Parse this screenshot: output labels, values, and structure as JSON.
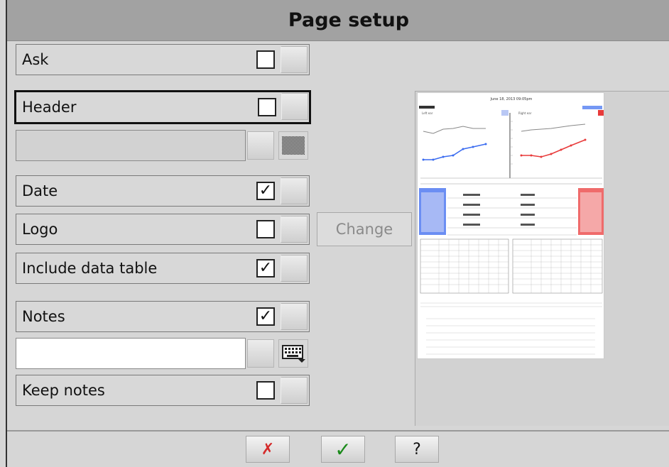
{
  "title": "Page setup",
  "options": [
    {
      "label": "Ask",
      "checked": false
    },
    {
      "label": "Header",
      "checked": false
    },
    {
      "label": "Date",
      "checked": true
    },
    {
      "label": "Logo",
      "checked": false
    },
    {
      "label": "Include data table",
      "checked": true
    },
    {
      "label": "Notes",
      "checked": true
    },
    {
      "label": "Keep notes",
      "checked": false
    }
  ],
  "marks": {
    "checked": "✓",
    "unchecked": ""
  },
  "logo": {
    "change_label": "Change"
  },
  "header_text": {
    "value": ""
  },
  "notes_text": {
    "value": ""
  },
  "footer": {
    "cancel_label": "✗",
    "ok_label": "✓",
    "help_label": "?"
  },
  "preview": {
    "page_title": "June 18, 2013 09:05pm",
    "left_label": "Left ear",
    "right_label": "Right ear"
  },
  "colors": {
    "cancel": "#d42a2a",
    "ok": "#1a8a1a",
    "left_ear": "#3b6cf0",
    "right_ear": "#e83a3a"
  }
}
